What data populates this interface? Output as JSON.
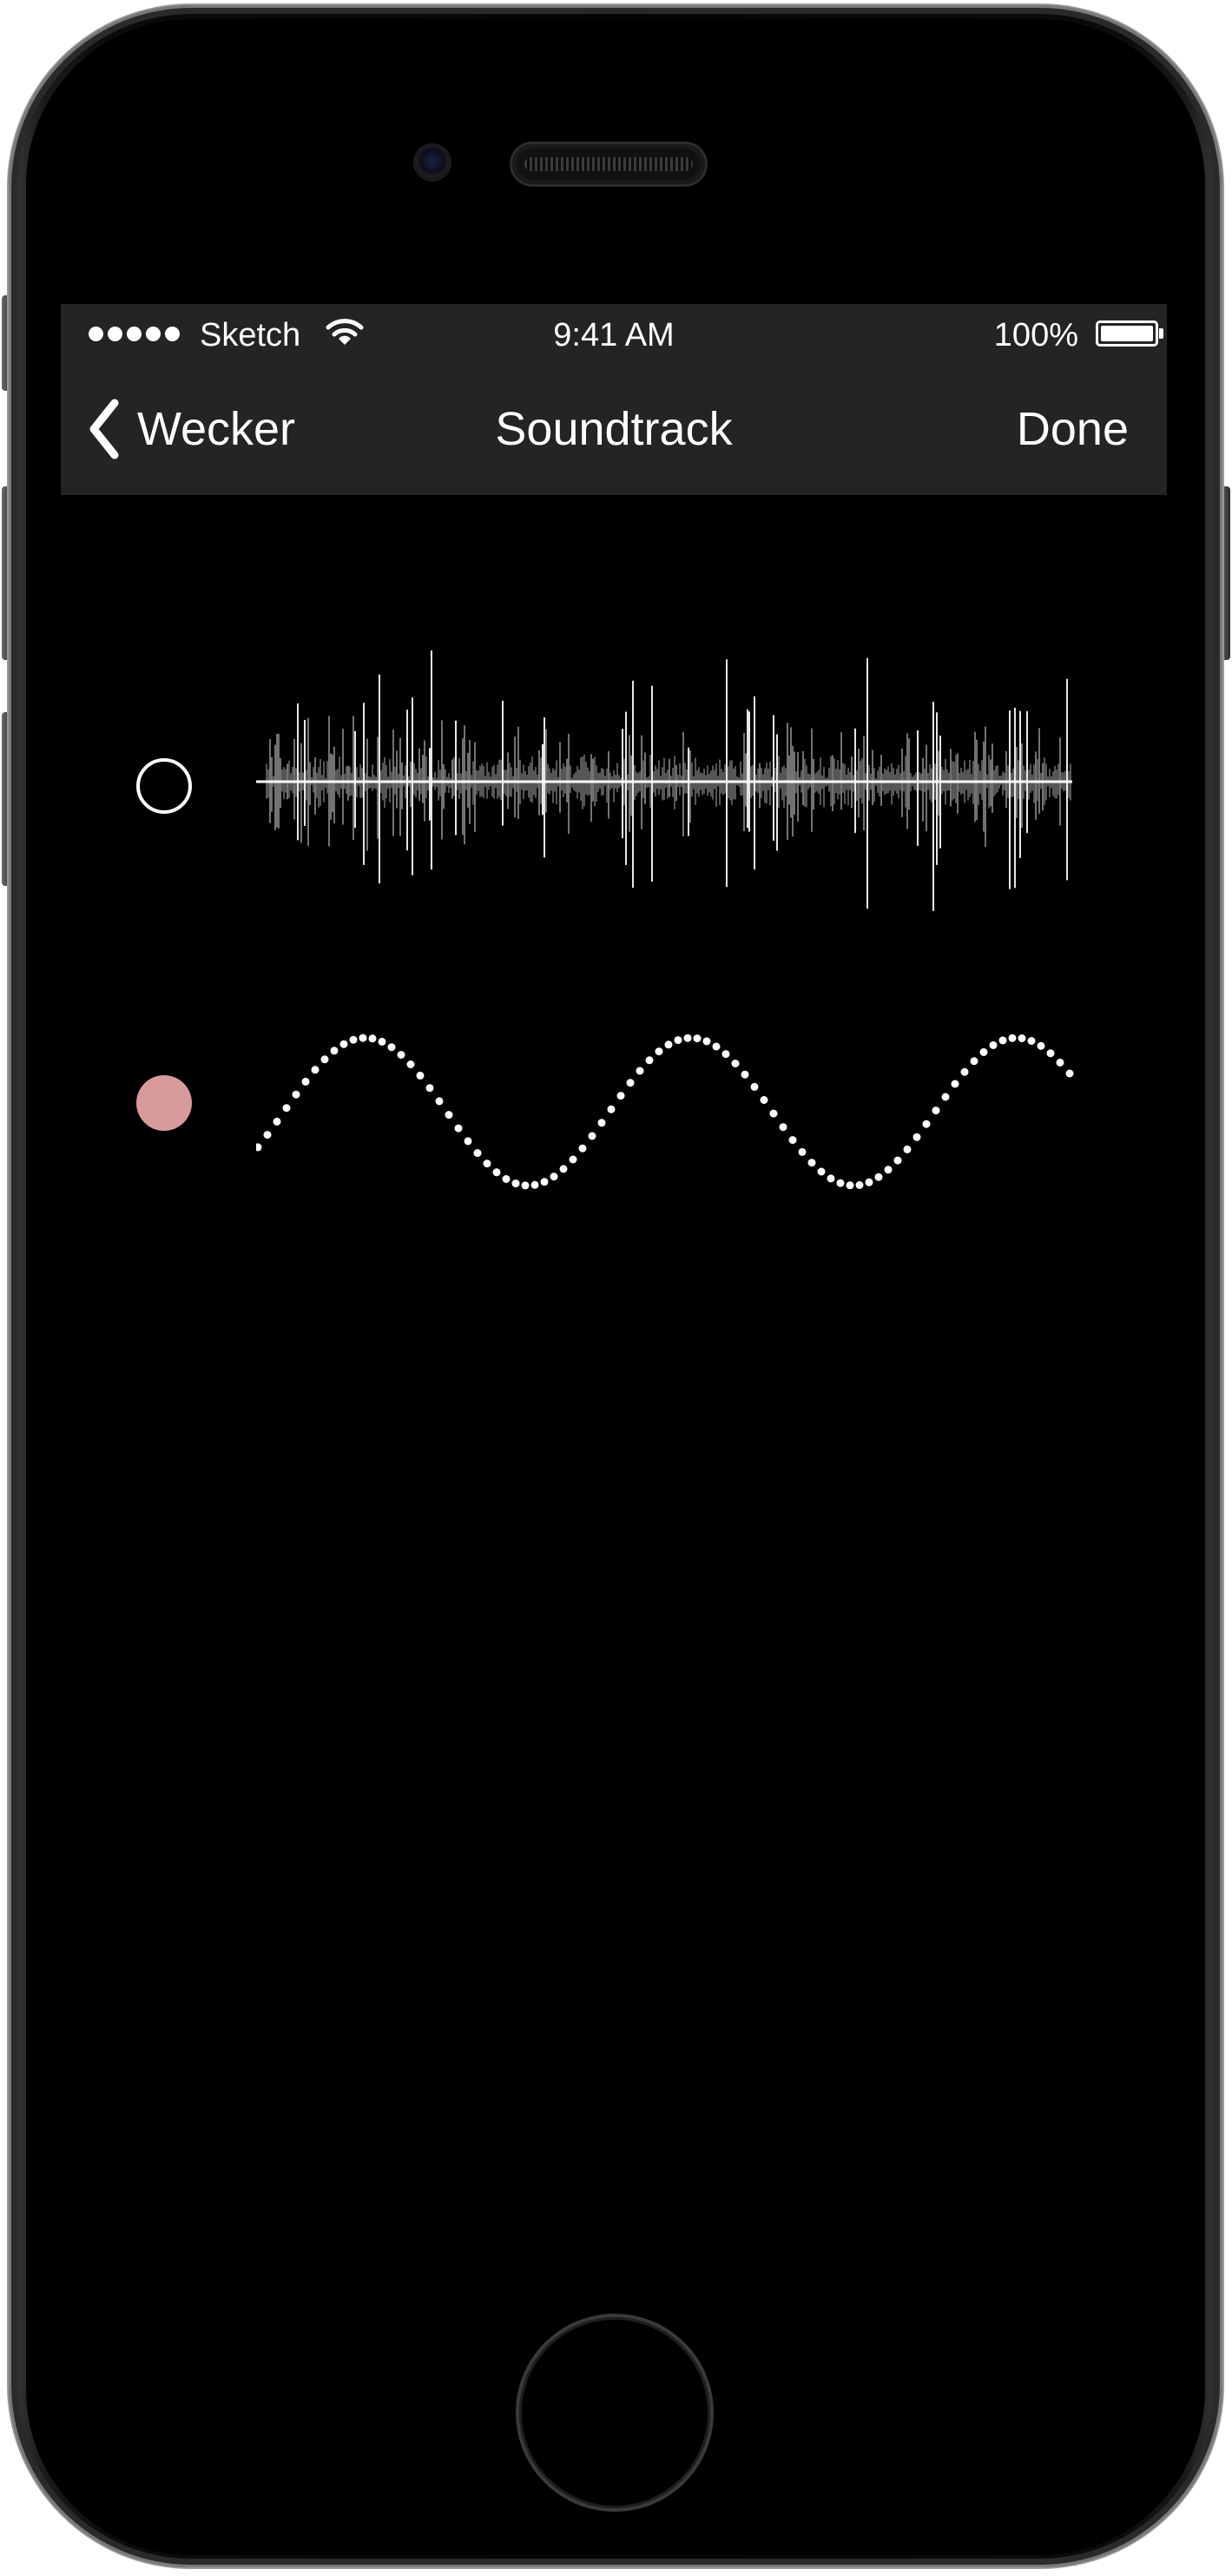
{
  "status_bar": {
    "carrier": "Sketch",
    "time": "9:41 AM",
    "battery_percent": "100%",
    "battery_level": 1.0,
    "signal_bars": 5
  },
  "nav": {
    "back_label": "Wecker",
    "title": "Soundtrack",
    "done_label": "Done"
  },
  "options": [
    {
      "name": "noise-waveform",
      "selected": false,
      "radio_color": "#ffffff"
    },
    {
      "name": "sine-waveform",
      "selected": true,
      "radio_color": "#d99a9c"
    }
  ],
  "colors": {
    "screen_bg": "#000000",
    "bar_bg": "#242424",
    "text": "#ffffff",
    "selected_accent": "#d99a9c"
  },
  "icons": {
    "back": "chevron-left-icon",
    "wifi": "wifi-icon",
    "battery": "battery-icon"
  }
}
